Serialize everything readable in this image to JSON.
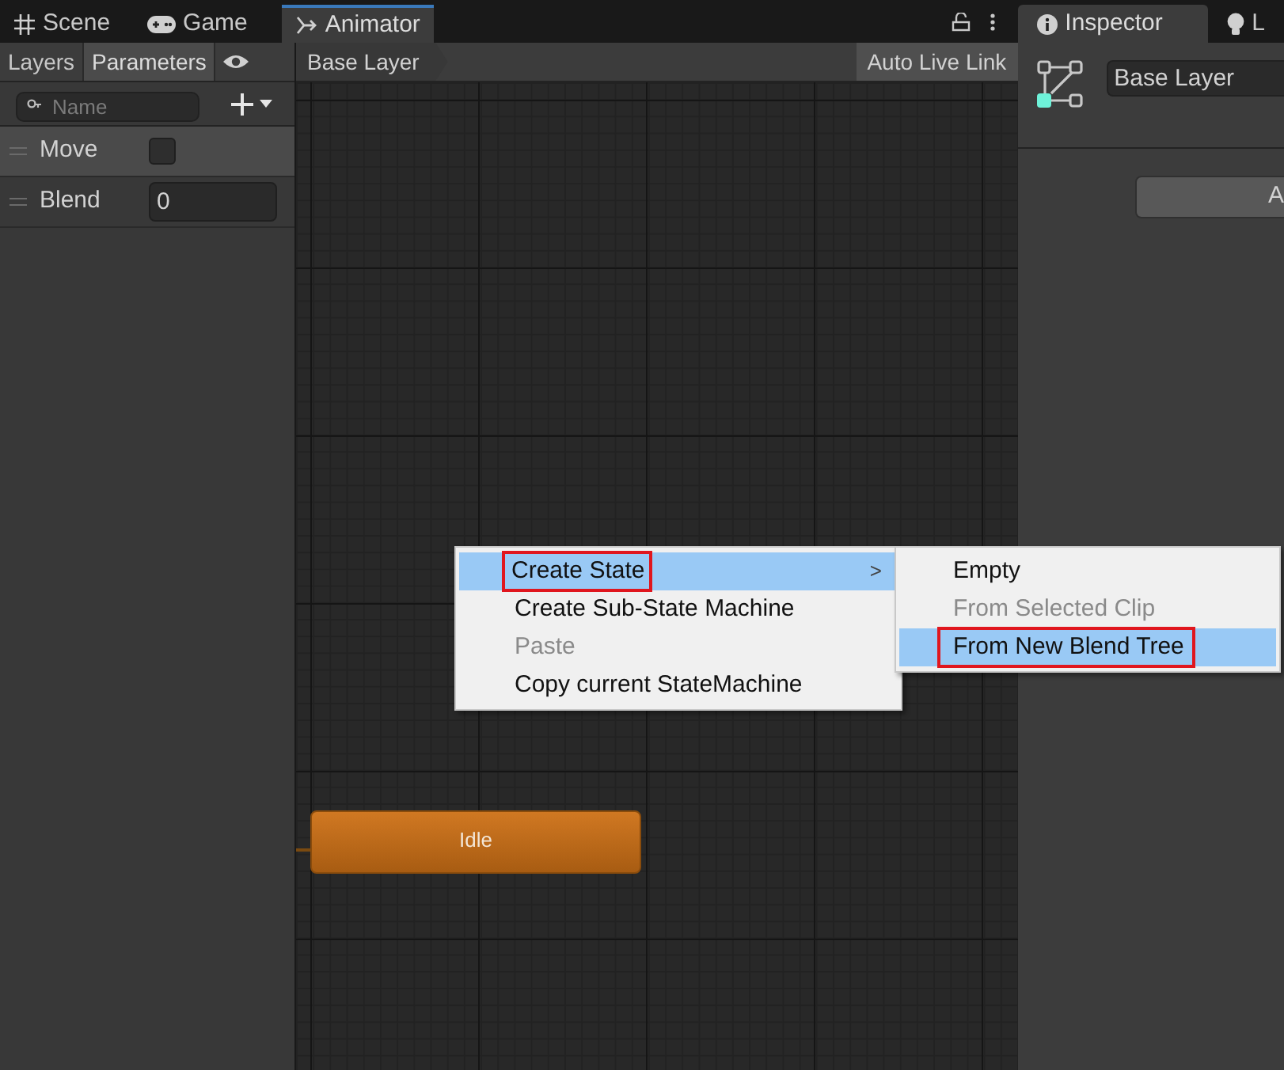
{
  "window_tabs": [
    {
      "label": "Scene",
      "selected": false
    },
    {
      "label": "Game",
      "selected": false
    },
    {
      "label": "Animator",
      "selected": true
    }
  ],
  "left_panel": {
    "tabs": [
      {
        "label": "Layers",
        "selected": false
      },
      {
        "label": "Parameters",
        "selected": true
      }
    ],
    "search": {
      "placeholder": "Name"
    },
    "parameters": [
      {
        "name": "Move",
        "kind": "bool",
        "checked": false,
        "selected": true
      },
      {
        "name": "Blend",
        "kind": "float",
        "value": "0",
        "selected": false
      }
    ]
  },
  "breadcrumb": "Base Layer",
  "auto_live_link": "Auto Live Link",
  "states": [
    {
      "name": "Idle"
    }
  ],
  "context_menu": {
    "items": [
      {
        "label": "Create State",
        "disabled": false,
        "selected": true,
        "submenu": true,
        "annotated": true
      },
      {
        "label": "Create Sub-State Machine",
        "disabled": false,
        "selected": false,
        "submenu": false,
        "annotated": false
      },
      {
        "label": "Paste",
        "disabled": true,
        "selected": false,
        "submenu": false,
        "annotated": false
      },
      {
        "label": "Copy current StateMachine",
        "disabled": false,
        "selected": false,
        "submenu": false,
        "annotated": false
      }
    ],
    "submenu_arrow": ">",
    "submenu": [
      {
        "label": "Empty",
        "disabled": false,
        "selected": false,
        "annotated": false
      },
      {
        "label": "From Selected Clip",
        "disabled": true,
        "selected": false,
        "annotated": false
      },
      {
        "label": "From New Blend Tree",
        "disabled": false,
        "selected": true,
        "annotated": true
      }
    ]
  },
  "inspector": {
    "tabs": [
      {
        "label": "Inspector",
        "selected": true
      },
      {
        "label": "L",
        "selected": false
      }
    ],
    "name_field": "Base Layer",
    "button": "A"
  }
}
